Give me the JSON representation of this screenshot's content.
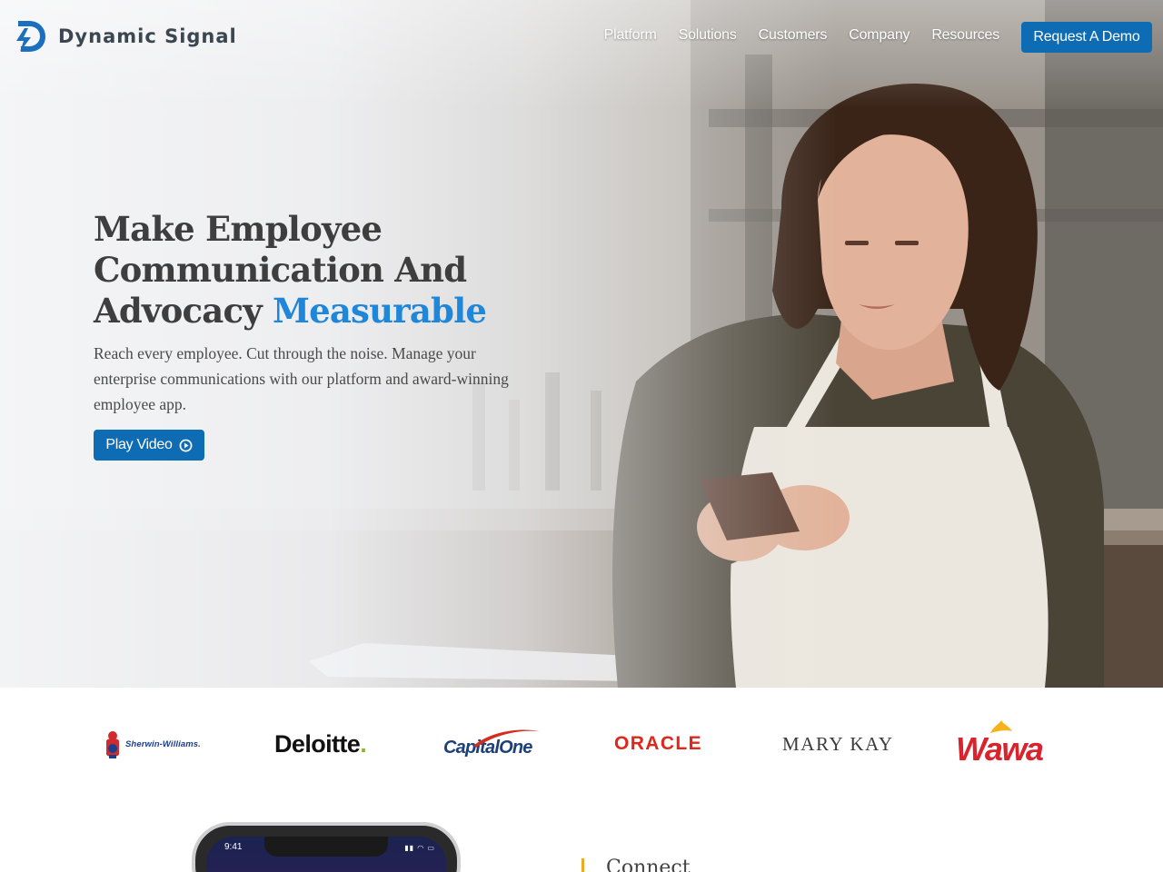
{
  "header": {
    "brand": "Dynamic Signal",
    "nav": [
      "Platform",
      "Solutions",
      "Customers",
      "Company",
      "Resources"
    ],
    "cta_label": "Request A Demo"
  },
  "hero": {
    "title_line1": "Make Employee",
    "title_line2": "Communication And",
    "title_line3_prefix": "Advocacy ",
    "title_accent": "Measurable",
    "subtitle": "Reach every employee. Cut through the noise. Manage your enterprise communications with our platform and award-winning employee app.",
    "play_label": "Play Video"
  },
  "clients": {
    "sherwin": "Sherwin-Williams.",
    "deloitte": "Deloitte",
    "deloitte_dot": ".",
    "capitalone": "CapitalOne",
    "oracle": "ORACLE",
    "marykay": "MARY KAY",
    "wawa": "Wawa"
  },
  "section": {
    "phone_time": "9:41",
    "heading": "Connect"
  },
  "colors": {
    "brand_blue": "#0e6cb4",
    "accent_blue": "#1f87d9",
    "accent_orange": "#f0a91f"
  },
  "icons": [
    "dynamic-signal-logo-icon",
    "play-circle-icon",
    "sherwin-williams-logo-icon",
    "capitalone-swoosh-icon",
    "wawa-goose-icon"
  ]
}
